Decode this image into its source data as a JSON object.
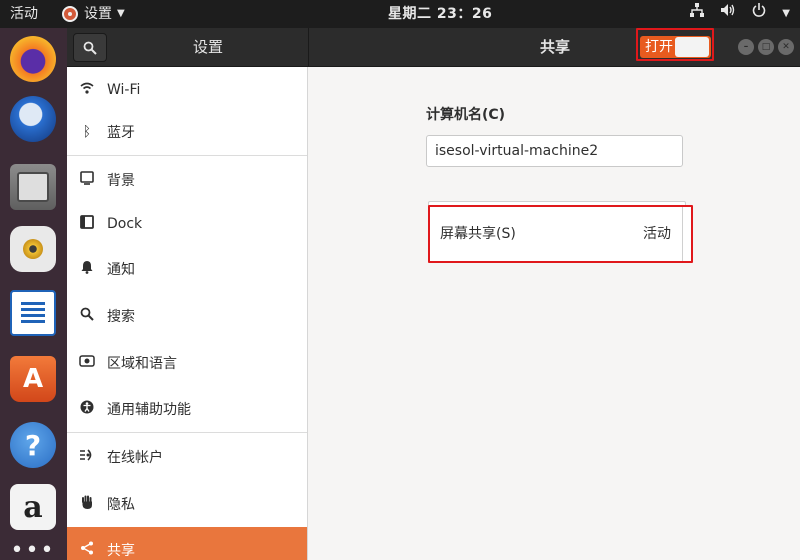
{
  "topbar": {
    "activities": "活动",
    "app_menu": "设置",
    "clock": "星期二 23：26",
    "tray_icons": [
      "network-icon",
      "volume-icon",
      "power-icon"
    ]
  },
  "dock": {
    "apps": [
      "Firefox",
      "Thunderbird",
      "Files",
      "Rhythmbox",
      "LibreOffice Writer",
      "Ubuntu Software",
      "Help",
      "Amazon",
      "Show Applications"
    ],
    "software_glyph": "A",
    "help_glyph": "?",
    "amazon_glyph": "a",
    "grid_glyph": "•••"
  },
  "headerbar": {
    "sidebar_title": "设置",
    "panel_title": "共享",
    "master_switch": {
      "label": "打开",
      "state": "on"
    },
    "window_controls": [
      "minimize",
      "maximize",
      "close"
    ]
  },
  "sidebar": {
    "items": [
      {
        "label": "Wi-Fi",
        "icon": "wifi-icon"
      },
      {
        "label": "蓝牙",
        "icon": "bluetooth-icon"
      },
      {
        "label": "背景",
        "icon": "background-icon"
      },
      {
        "label": "Dock",
        "icon": "dock-icon"
      },
      {
        "label": "通知",
        "icon": "bell-icon"
      },
      {
        "label": "搜索",
        "icon": "search-icon"
      },
      {
        "label": "区域和语言",
        "icon": "region-icon"
      },
      {
        "label": "通用辅助功能",
        "icon": "accessibility-icon"
      },
      {
        "label": "在线帐户",
        "icon": "online-accounts-icon"
      },
      {
        "label": "隐私",
        "icon": "privacy-hand-icon"
      },
      {
        "label": "共享",
        "icon": "share-icon",
        "active": true
      }
    ]
  },
  "main": {
    "computer_name_label": "计算机名(C)",
    "computer_name_value": "isesol-virtual-machine2",
    "screen_share": {
      "label": "屏幕共享(S)",
      "status": "活动"
    }
  },
  "colors": {
    "accent": "#e9763d",
    "highlight_box": "#e0181b",
    "topbar_bg": "#1d1d1d",
    "dock_bg": "#3b2b36",
    "headerbar_bg": "#2c2c2c"
  }
}
